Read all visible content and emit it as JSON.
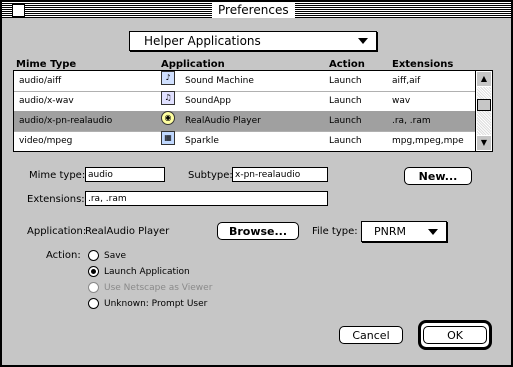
{
  "window": {
    "title": "Preferences"
  },
  "popup": {
    "selected": "Helper Applications"
  },
  "table": {
    "headers": {
      "mime": "Mime Type",
      "app": "Application",
      "action": "Action",
      "ext": "Extensions"
    },
    "rows": [
      {
        "mime": "audio/aiff",
        "icon": "sound-machine-icon",
        "app": "Sound Machine",
        "action": "Launch",
        "ext": "aiff,aif"
      },
      {
        "mime": "audio/x-wav",
        "icon": "soundapp-icon",
        "app": "SoundApp",
        "action": "Launch",
        "ext": "wav"
      },
      {
        "mime": "audio/x-pn-realaudio",
        "icon": "realaudio-icon",
        "app": "RealAudio Player",
        "action": "Launch",
        "ext": ".ra, .ram"
      },
      {
        "mime": "video/mpeg",
        "icon": "sparkle-icon",
        "app": "Sparkle",
        "action": "Launch",
        "ext": "mpg,mpeg,mpe"
      }
    ]
  },
  "form": {
    "mime_label": "Mime type:",
    "mime_value": "audio",
    "subtype_label": "Subtype:",
    "subtype_value": "x-pn-realaudio",
    "new_button": "New...",
    "ext_label": "Extensions:",
    "ext_value": ".ra, .ram",
    "app_label": "Application:",
    "app_value": "RealAudio Player",
    "browse_button": "Browse...",
    "filetype_label": "File type:",
    "filetype_value": "PNRM",
    "action_label": "Action:",
    "actions": [
      "Save",
      "Launch Application",
      "Use Netscape as Viewer",
      "Unknown: Prompt User"
    ]
  },
  "buttons": {
    "cancel": "Cancel",
    "ok": "OK"
  }
}
